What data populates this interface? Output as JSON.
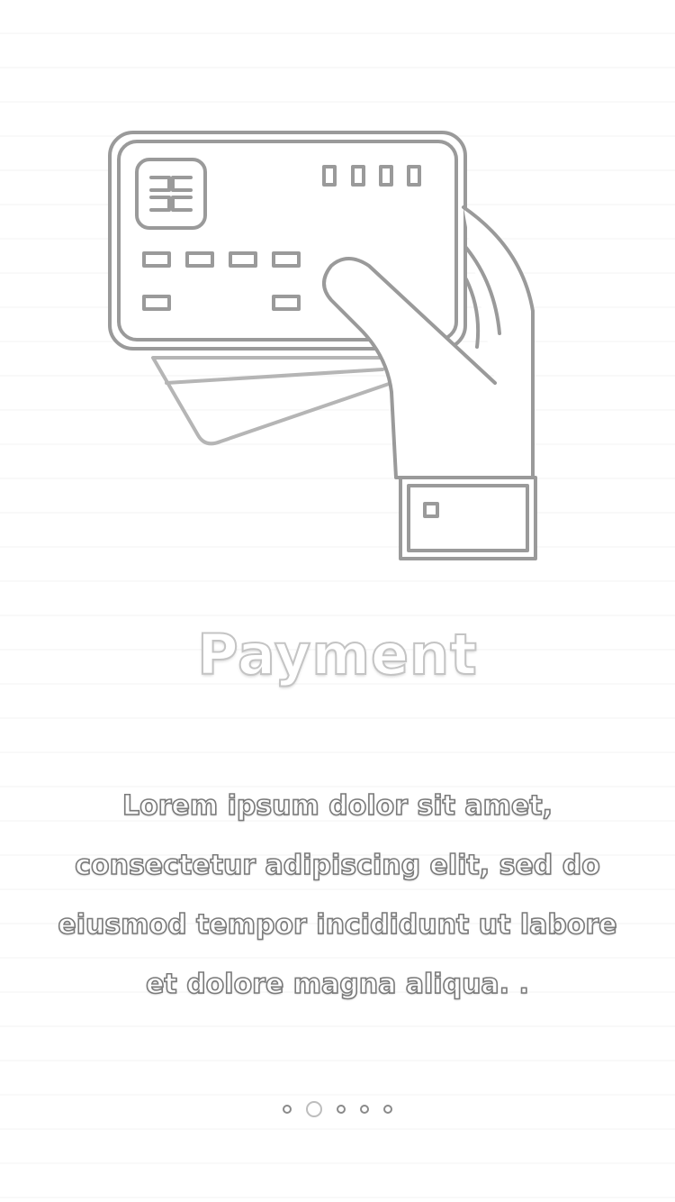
{
  "screen": {
    "title": "Payment",
    "description": "Lorem ipsum dolor sit amet, consectetur adipiscing elit, sed do eiusmod tempor incididunt ut labore et dolore magna aliqua. .",
    "illustration_icon": "hand-holding-credit-card-icon"
  },
  "pagination": {
    "total": 5,
    "active_index": 1
  }
}
